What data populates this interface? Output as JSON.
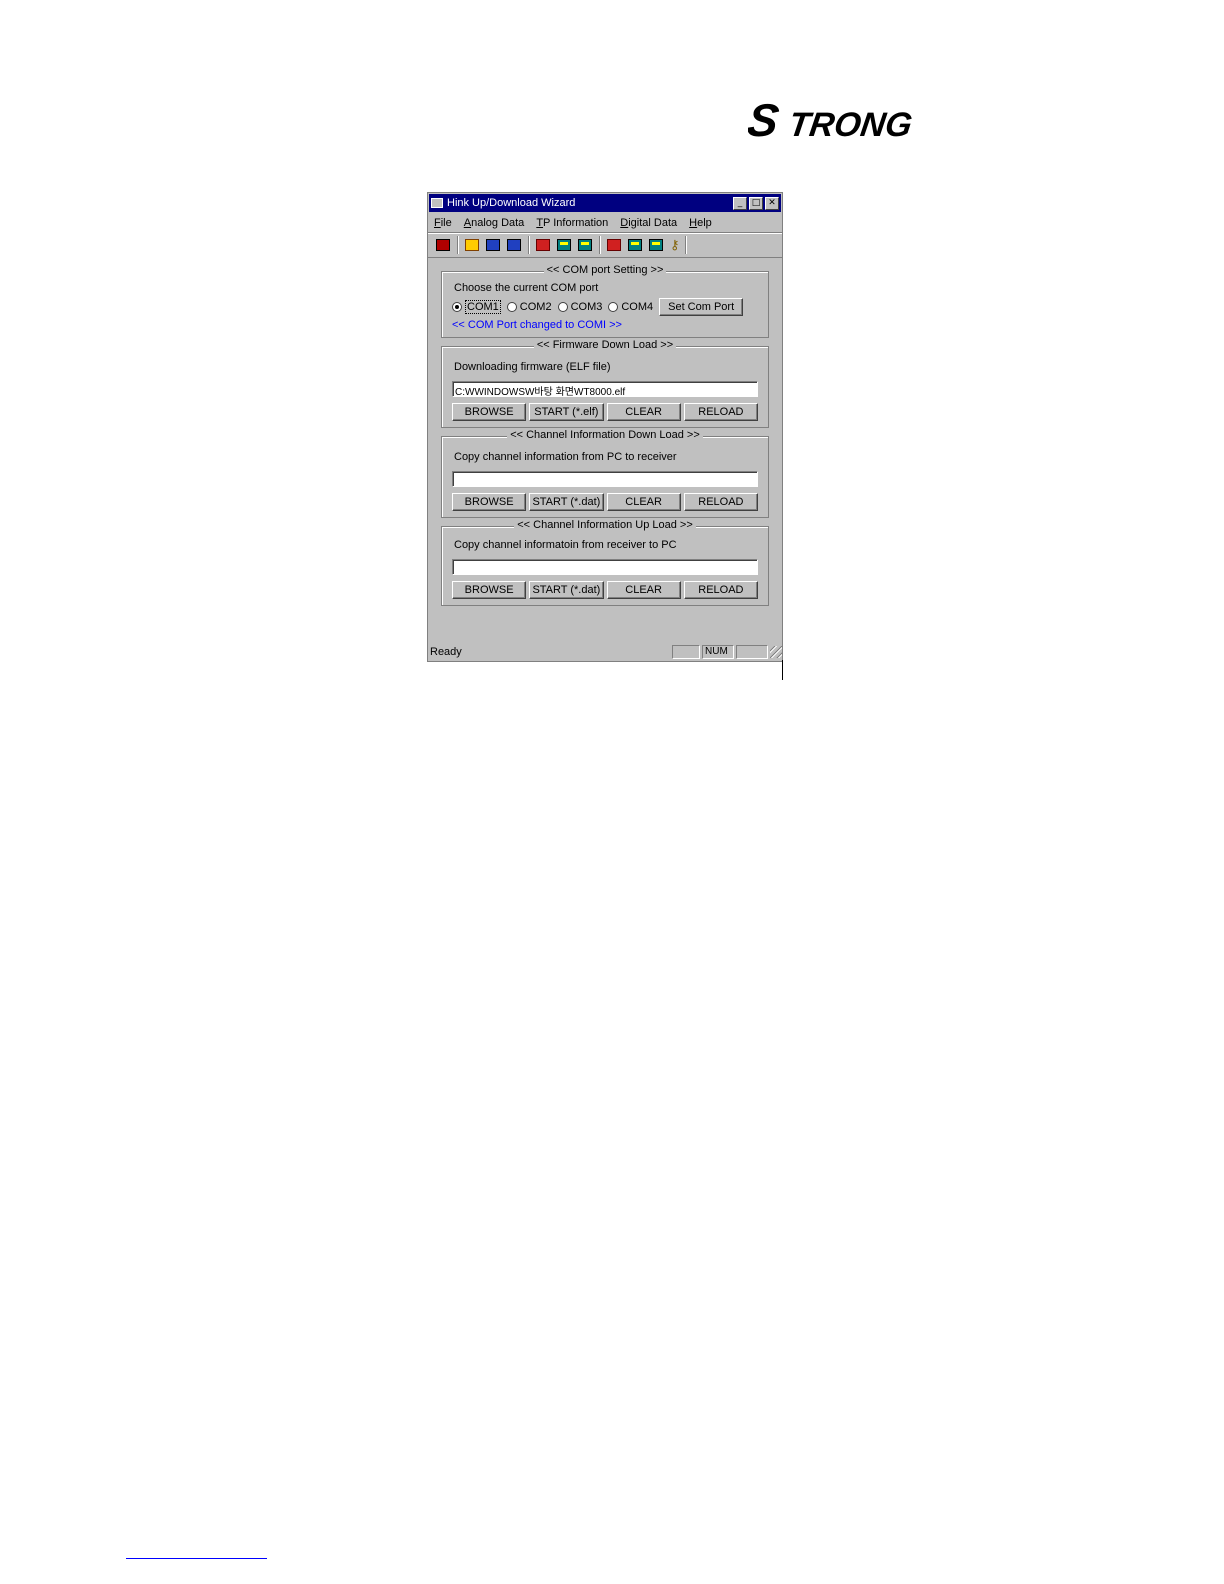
{
  "brand": {
    "logo_text": "STRONG"
  },
  "window": {
    "title": "Hink Up/Download Wizard",
    "controls": {
      "minimize": "_",
      "maximize": "□",
      "close": "✕"
    }
  },
  "menu": {
    "items": [
      {
        "label": "File",
        "accel": "F",
        "rest": "ile"
      },
      {
        "label": "Analog Data",
        "accel": "A",
        "rest": "nalog Data"
      },
      {
        "label": "TP Information",
        "accel": "T",
        "rest": "P Information"
      },
      {
        "label": "Digital Data",
        "accel": "D",
        "rest": "igital Data"
      },
      {
        "label": "Help",
        "accel": "H",
        "rest": "elp"
      }
    ]
  },
  "toolbar": {
    "icons": [
      "receiver-icon",
      "open-folder-icon",
      "download-icon",
      "upload-icon",
      "analog-send-icon",
      "monitor-icon",
      "monitor-icon",
      "tp-send-icon",
      "monitor-icon",
      "monitor-icon",
      "key-icon"
    ]
  },
  "com_group": {
    "legend": "<< COM port Setting >>",
    "label": "Choose the current COM port",
    "options": [
      "COM1",
      "COM2",
      "COM3",
      "COM4"
    ],
    "selected": "COM1",
    "set_button": "Set Com Port",
    "status": "<< COM Port changed to COMI >>"
  },
  "firmware_group": {
    "legend": "<< Firmware Down Load >>",
    "label": "Downloading firmware (ELF file)",
    "path": "C:WWINDOWSW바탕 화면WT8000.elf",
    "browse": "BROWSE",
    "start": "START (*.elf)",
    "clear": "CLEAR",
    "reload": "RELOAD"
  },
  "channel_down_group": {
    "legend": "<< Channel Information Down Load >>",
    "label": "Copy channel information from PC to receiver",
    "path": "",
    "browse": "BROWSE",
    "start": "START (*.dat)",
    "clear": "CLEAR",
    "reload": "RELOAD"
  },
  "channel_up_group": {
    "legend": "<< Channel Information Up Load >>",
    "label": "Copy channel informatoin from receiver to PC",
    "path": "",
    "browse": "BROWSE",
    "start": "START (*.dat)",
    "clear": "CLEAR",
    "reload": "RELOAD"
  },
  "statusbar": {
    "text": "Ready",
    "pane1": "",
    "pane2": "NUM",
    "pane3": ""
  }
}
